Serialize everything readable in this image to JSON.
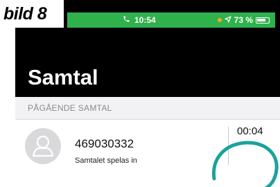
{
  "annotation": {
    "label": "bild 8"
  },
  "status_bar": {
    "time": "10:54",
    "battery_text": "73 %",
    "background_color": "#2fb14b"
  },
  "header": {
    "title": "Samtal"
  },
  "section": {
    "label": "PÅGÅENDE SAMTAL"
  },
  "call": {
    "number": "469030332",
    "status": "Samtalet spelas in",
    "duration": "00:04",
    "avatar_icon": "person-icon",
    "stop_icon": "stop-icon"
  },
  "colors": {
    "highlight": "#1aa39a",
    "header_bg": "#000000",
    "section_bg": "#f2f2f4"
  }
}
